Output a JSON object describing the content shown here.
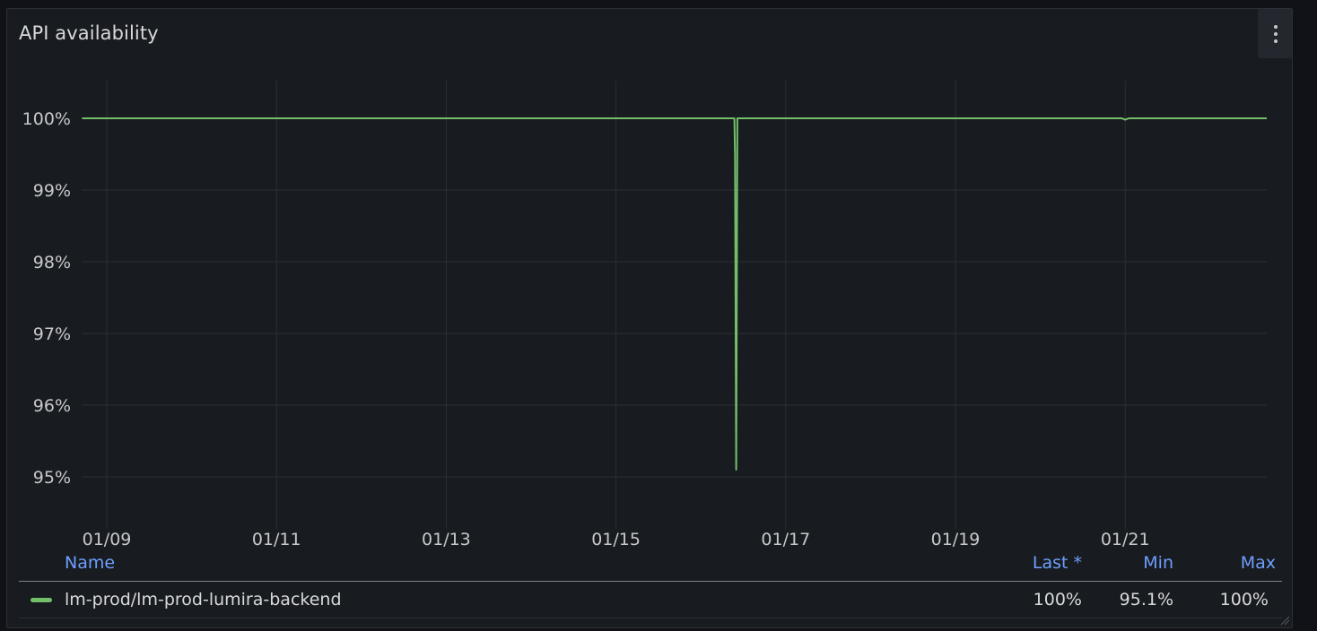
{
  "panel": {
    "title": "API availability",
    "menu_icon": "kebab-vertical-icon"
  },
  "colors": {
    "series": "#73bf69",
    "grid": "#2c2f35",
    "axis_text": "#c7c8cb",
    "legend_header": "#6e9fff"
  },
  "chart_data": {
    "type": "line",
    "y_ticks": [
      "100%",
      "99%",
      "98%",
      "97%",
      "96%",
      "95%"
    ],
    "x_ticks": [
      "01/09",
      "01/11",
      "01/13",
      "01/15",
      "01/17",
      "01/19",
      "01/21"
    ],
    "ylim": [
      94.5,
      100.5
    ],
    "series": [
      {
        "name": "lm-prod/lm-prod-lumira-backend",
        "points": [
          {
            "x": "01/08 17:00",
            "y": 100
          },
          {
            "x": "01/16 09:30",
            "y": 100
          },
          {
            "x": "01/16 09:40",
            "y": 99.5
          },
          {
            "x": "01/16 10:00",
            "y": 95.1
          },
          {
            "x": "01/16 10:20",
            "y": 100
          },
          {
            "x": "01/20 23:00",
            "y": 100
          },
          {
            "x": "01/21 00:00",
            "y": 99.98
          },
          {
            "x": "01/21 01:00",
            "y": 100
          },
          {
            "x": "01/22 17:00",
            "y": 100
          }
        ]
      }
    ]
  },
  "legend": {
    "headers": {
      "name": "Name",
      "last": "Last *",
      "min": "Min",
      "max": "Max"
    },
    "rows": [
      {
        "name": "lm-prod/lm-prod-lumira-backend",
        "last": "100%",
        "min": "95.1%",
        "max": "100%"
      }
    ]
  }
}
